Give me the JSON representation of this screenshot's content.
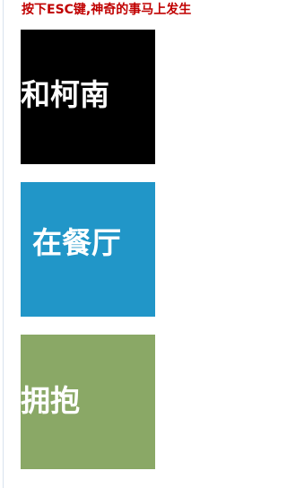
{
  "notice": {
    "text": "按下ESC键,神奇的事马上发生",
    "color": "#c00000"
  },
  "tiles": [
    {
      "label": "和柯南",
      "background": "#000000"
    },
    {
      "label": "在餐厅",
      "background": "#2196c8"
    },
    {
      "label": "拥抱",
      "background": "#8aa866"
    }
  ]
}
